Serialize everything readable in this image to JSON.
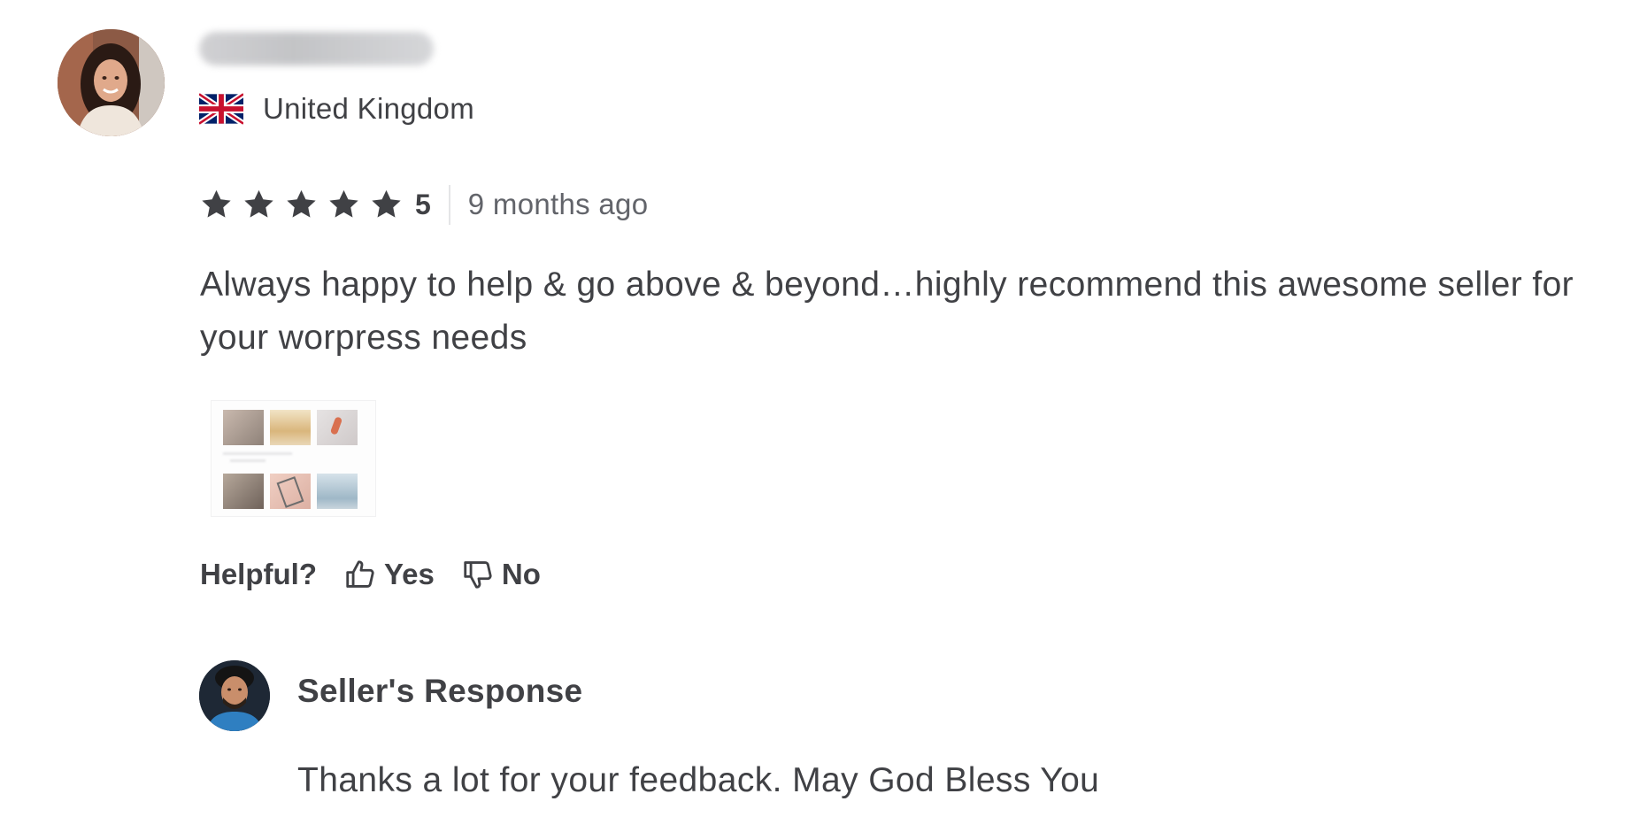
{
  "review": {
    "reviewer": {
      "avatar_icon": "reviewer-avatar",
      "country": "United Kingdom",
      "flag_icon": "uk-flag-icon"
    },
    "rating": {
      "stars": 5,
      "value": "5",
      "star_color": "#404145"
    },
    "time_ago": "9 months ago",
    "text": "Always happy to help & go above & beyond…highly recommend this awesome seller for your worpress needs",
    "attachment_icon": "image-attachment-thumbnail",
    "helpful": {
      "label": "Helpful?",
      "yes_label": "Yes",
      "no_label": "No",
      "yes_icon": "thumbs-up-icon",
      "no_icon": "thumbs-down-icon"
    }
  },
  "seller_response": {
    "avatar_icon": "seller-avatar",
    "title": "Seller's Response",
    "text": "Thanks a lot for your feedback. May God Bless You"
  }
}
